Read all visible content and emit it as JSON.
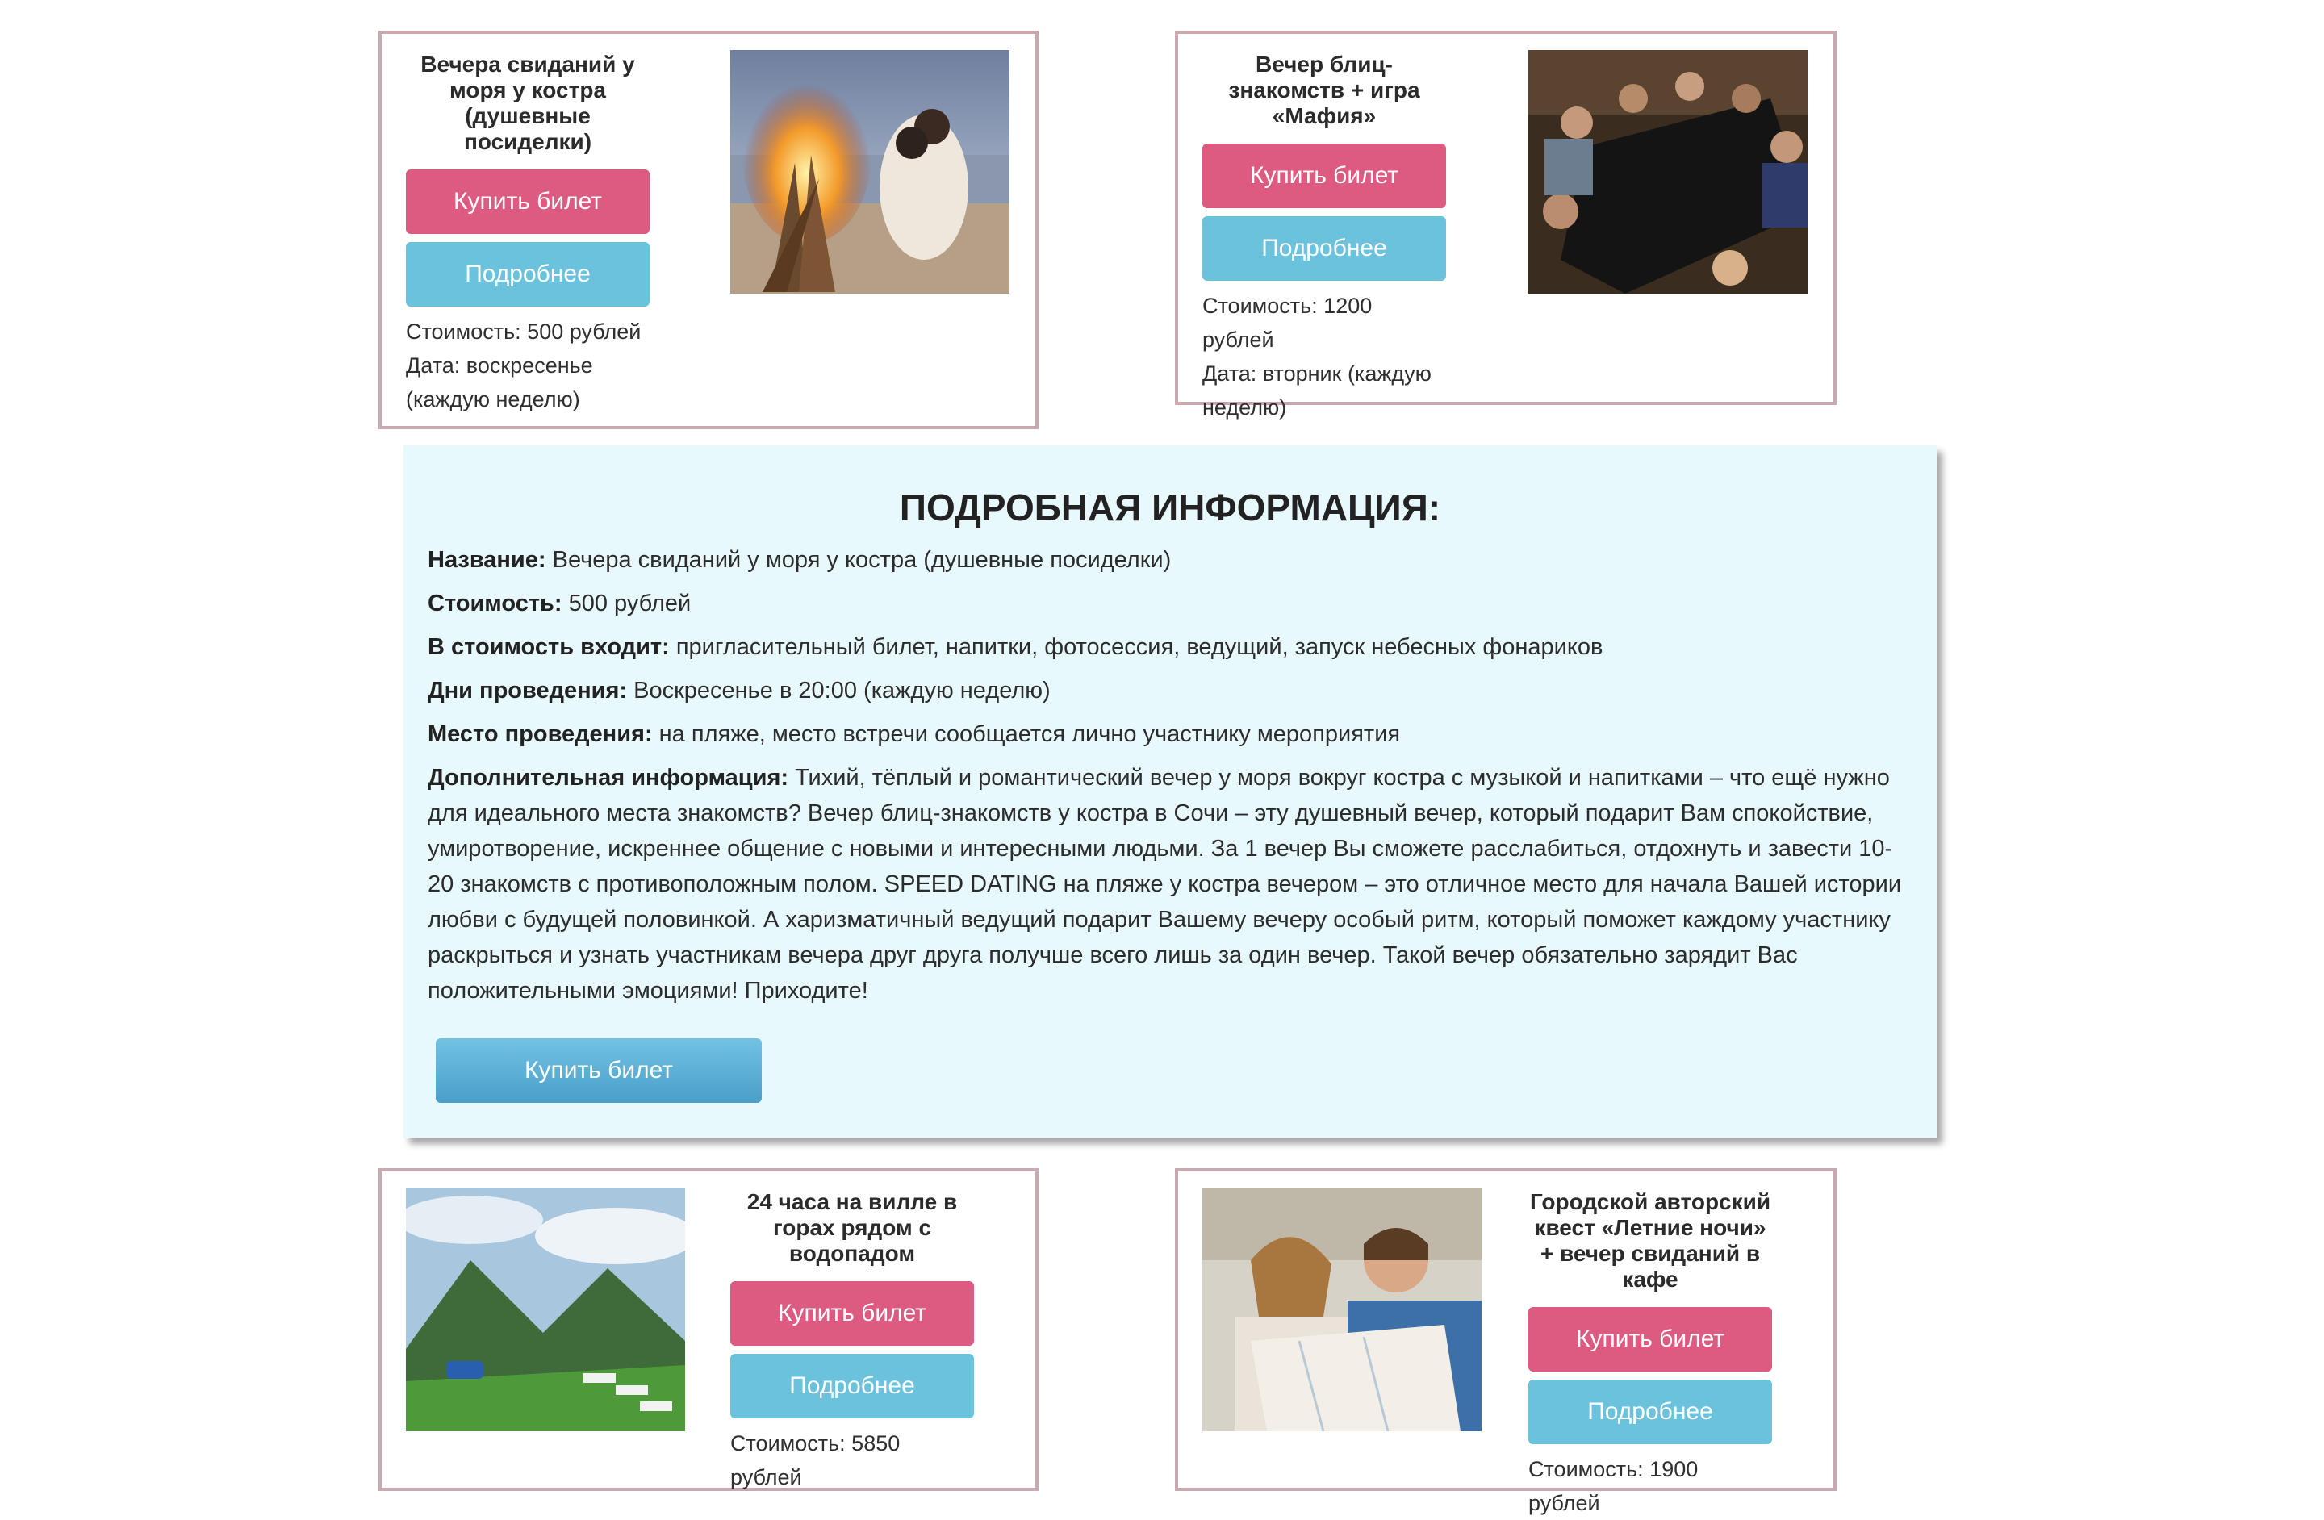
{
  "cards": [
    {
      "title": "Вечера свиданий у моря у костра (душевные посиделки)",
      "buy": "Купить билет",
      "more": "Подробнее",
      "price": "Стоимость: 500 рублей",
      "date": "Дата: воскресенье (каждую неделю)"
    },
    {
      "title": "Вечер блиц-знакомств + игра «Мафия»",
      "buy": "Купить билет",
      "more": "Подробнее",
      "price": "Стоимость: 1200 рублей",
      "date": "Дата: вторник (каждую неделю)"
    },
    {
      "title": "24 часа на вилле в горах рядом с водопадом",
      "buy": "Купить билет",
      "more": "Подробнее",
      "price": "Стоимость: 5850 рублей"
    },
    {
      "title": "Городской авторский квест «Летние ночи» + вечер свиданий в кафе",
      "buy": "Купить билет",
      "more": "Подробнее",
      "price": "Стоимость: 1900 рублей"
    }
  ],
  "details": {
    "heading": "ПОДРОБНАЯ ИНФОРМАЦИЯ:",
    "name_label": "Название:",
    "name_value": " Вечера свиданий у моря у костра (душевные посиделки)",
    "price_label": "Стоимость:",
    "price_value": " 500 рублей",
    "includes_label": "В стоимость входит:",
    "includes_value": " пригласительный билет, напитки, фотосессия, ведущий, запуск небесных фонариков",
    "days_label": "Дни проведения:",
    "days_value": " Воскресенье в 20:00 (каждую неделю)",
    "place_label": "Место проведения:",
    "place_value": " на пляже, место встречи сообщается лично участнику мероприятия",
    "extra_label": "Дополнительная информация:",
    "extra_value": " Тихий, тёплый и романтический вечер у моря вокруг костра с музыкой и напитками – что ещё нужно для идеального места знакомств? Вечер блиц-знакомств у костра в Сочи – эту душевный вечер, который подарит Вам спокойствие, умиротворение, искреннее общение с новыми и интересными людьми. За 1 вечер Вы сможете расслабиться, отдохнуть и завести 10-20 знакомств с противоположным полом. SPEED DATING на пляже у костра вечером – это отличное место для начала Вашей истории любви с будущей половинкой. А харизматичный ведущий подарит Вашему вечеру особый ритм, который поможет каждому участнику раскрыться и узнать участникам вечера друг друга получше всего лишь за один вечер. Такой вечер обязательно зарядит Вас положительными эмоциями! Приходите!",
    "buy_button": "Купить билет"
  }
}
